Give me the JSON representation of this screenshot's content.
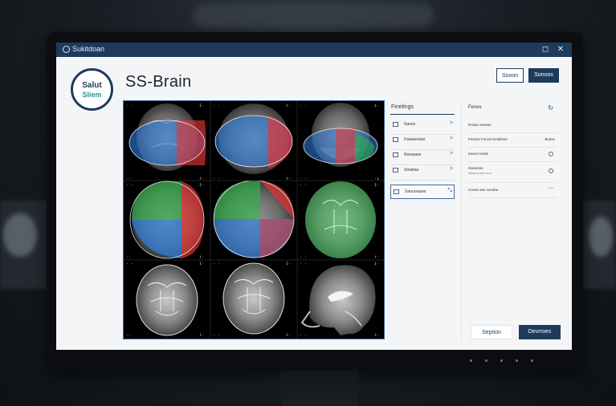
{
  "window": {
    "app_title": "Sukitdoan",
    "controls": [
      "◻",
      "✕"
    ]
  },
  "logo": {
    "line1": "Salut",
    "line2": "Sliem"
  },
  "page": {
    "title": "SS-Brain"
  },
  "header_buttons": [
    {
      "label": "Sooon"
    },
    {
      "label": "Sonoos"
    }
  ],
  "viewer": {
    "rows": 3,
    "cols": 3,
    "overlay_colors": {
      "blue": "#2f7fe0",
      "red": "#e53535",
      "green": "#2fb24a"
    }
  },
  "findings_panel": {
    "header": "Finelings",
    "items": [
      {
        "label": "Sanos",
        "icon": "document-icon",
        "chevron": ">"
      },
      {
        "label": "Fasaaorase",
        "icon": "list-icon",
        "chevron": ">"
      },
      {
        "label": "Norasase",
        "icon": "grid-icon",
        "chevron": ">"
      },
      {
        "label": "Sinabsa",
        "icon": "grid-icon",
        "chevron": ">"
      }
    ],
    "selected_item": {
      "label": "Sanursases",
      "icon": "document-icon",
      "chevron": "⤡"
    }
  },
  "right_panel": {
    "header": "Fenes",
    "refresh_icon": "↻",
    "rows": [
      {
        "label": "Rosan asnesn",
        "control": "none"
      },
      {
        "label": "Fesnes Forces Endense",
        "value": "Bosse",
        "control": "value"
      },
      {
        "label": "Kanos tosok",
        "control": "radio"
      },
      {
        "label": "Sisanose",
        "sub": "Nasanorsane sose",
        "control": "radio"
      },
      {
        "label": "Conse ass nosobe",
        "control": "dash",
        "dash": "—"
      }
    ]
  },
  "footer_buttons": [
    {
      "label": "Seption"
    },
    {
      "label": "Devrroes"
    }
  ]
}
